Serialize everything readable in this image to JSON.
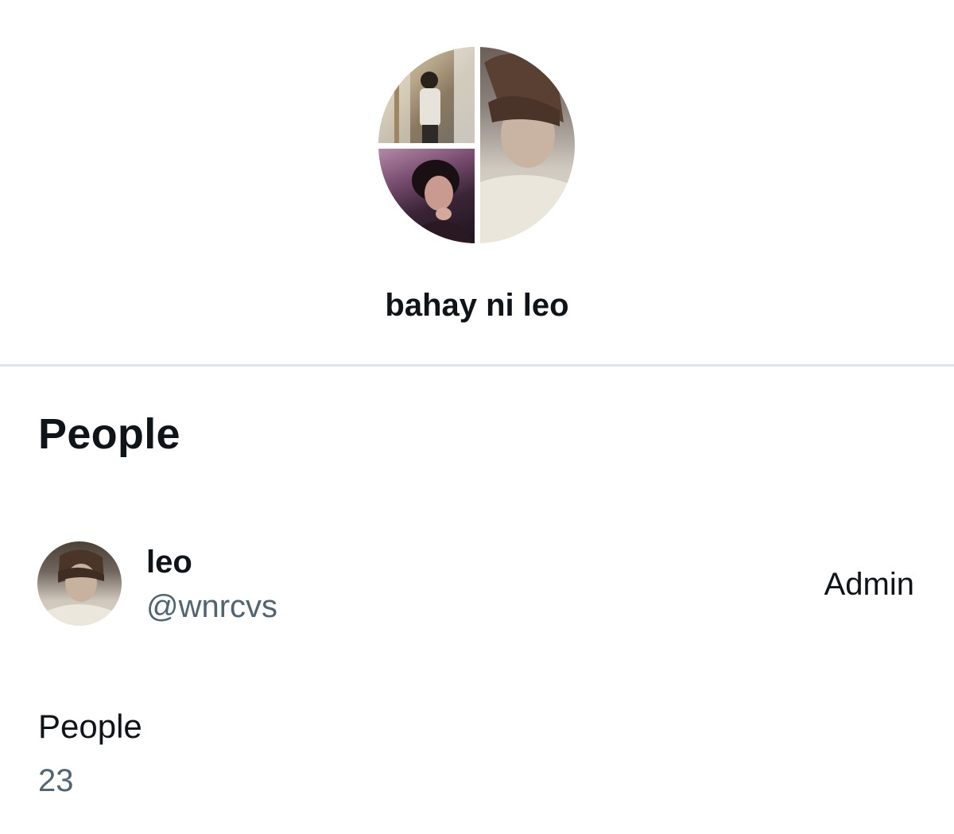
{
  "group": {
    "name": "bahay ni leo"
  },
  "people_section": {
    "heading": "People",
    "members": [
      {
        "name": "leo",
        "handle": "@wnrcvs",
        "role": "Admin"
      }
    ]
  },
  "stats": {
    "label": "People",
    "count": "23"
  }
}
